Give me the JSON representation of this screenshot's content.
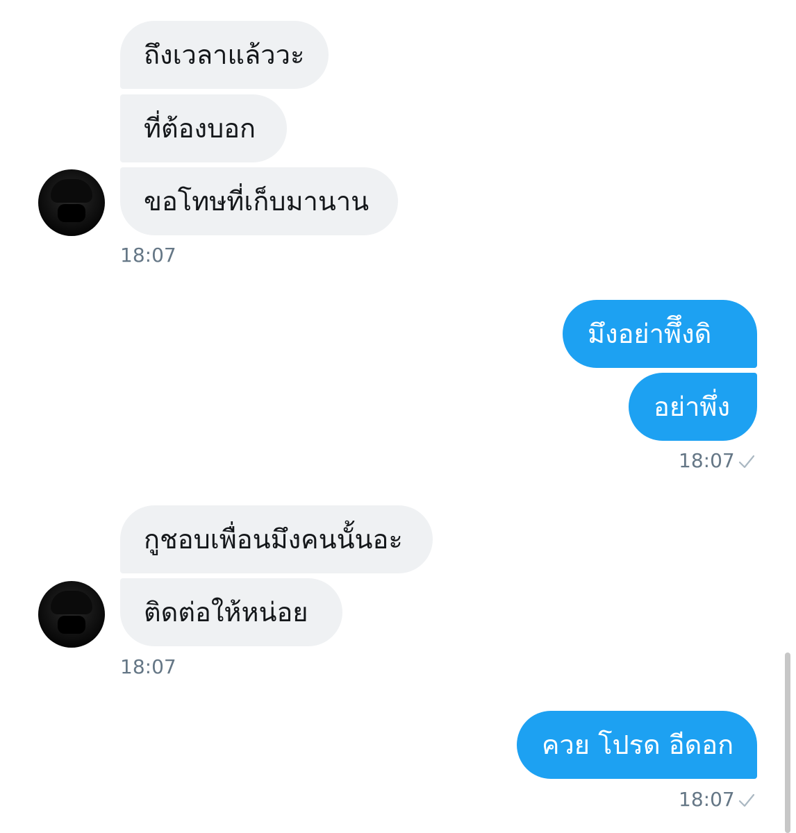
{
  "colors": {
    "incoming_bubble": "#eff1f3",
    "outgoing_bubble": "#1da1f2",
    "timestamp": "#657786",
    "background": "#ffffff"
  },
  "messages": {
    "group1": {
      "lines": [
        "ถึงเวลาแล้ววะ",
        "ที่ต้องบอก",
        "ขอโทษที่เก็บมานาน"
      ],
      "time": "18:07"
    },
    "group2": {
      "lines": [
        "มึงอย่าพึึงดิ",
        "อย่าพึ่ง"
      ],
      "time": "18:07",
      "status_icon": "check-icon"
    },
    "group3": {
      "lines": [
        "กูชอบเพื่อนมึงคนนั้นอะ",
        "ติดต่อให้หน่อย"
      ],
      "time": "18:07"
    },
    "group4": {
      "lines": [
        "ควย โปรด อีดอก"
      ],
      "time": "18:07",
      "status_icon": "check-icon"
    }
  }
}
